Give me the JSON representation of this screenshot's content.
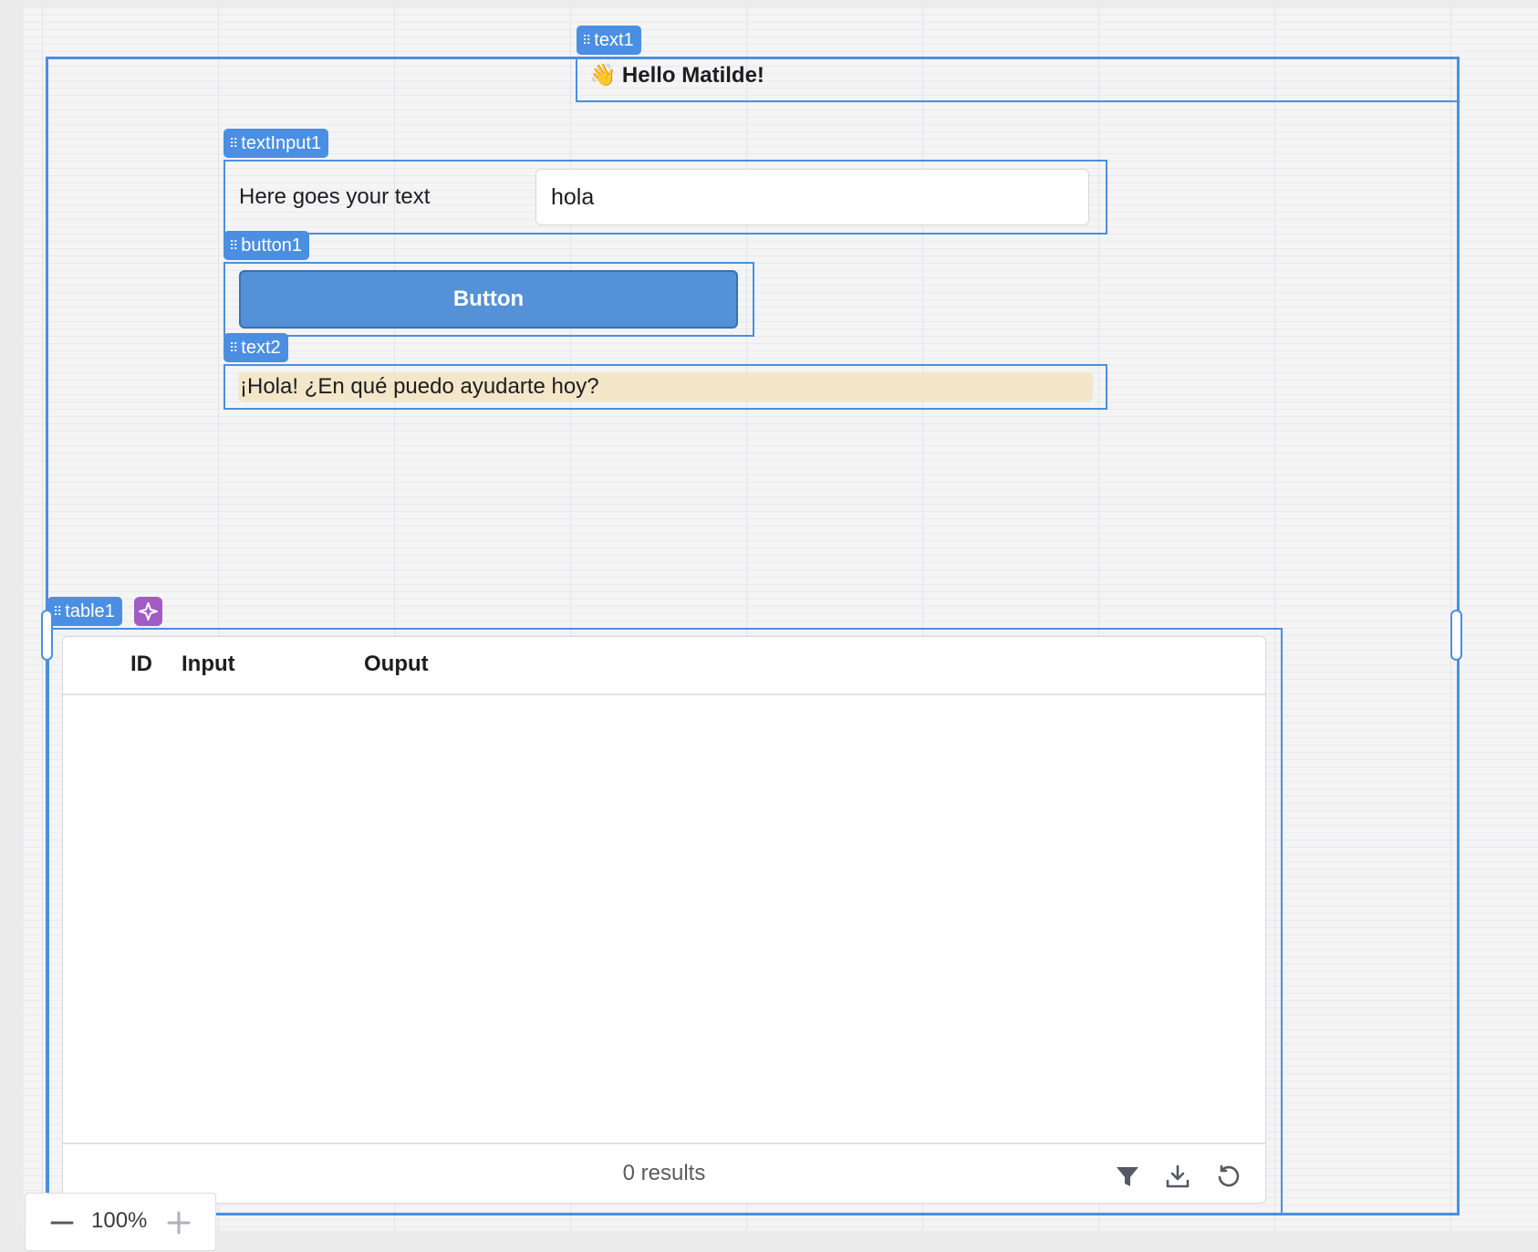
{
  "components": {
    "text1": {
      "tag": "text1",
      "content": "Hello Matilde!",
      "emoji": "👋"
    },
    "textInput1": {
      "tag": "textInput1",
      "label": "Here goes your text",
      "value": "hola"
    },
    "button1": {
      "tag": "button1",
      "label": "Button"
    },
    "text2": {
      "tag": "text2",
      "content": "¡Hola! ¿En qué puedo ayudarte hoy?"
    },
    "table1": {
      "tag": "table1",
      "columns": [
        "ID",
        "Input",
        "Ouput"
      ],
      "rows": [],
      "results": "0 results"
    }
  },
  "zoom": {
    "value": "100%"
  },
  "colors": {
    "selection": "#4a8fe2",
    "button": "#5591d6",
    "highlight": "#f3e6c9",
    "ai_badge": "#a25bc4"
  },
  "icons": [
    "drag-handle-icon",
    "sparkle-icon",
    "filter-icon",
    "download-icon",
    "refresh-icon",
    "minus-icon",
    "plus-icon"
  ]
}
